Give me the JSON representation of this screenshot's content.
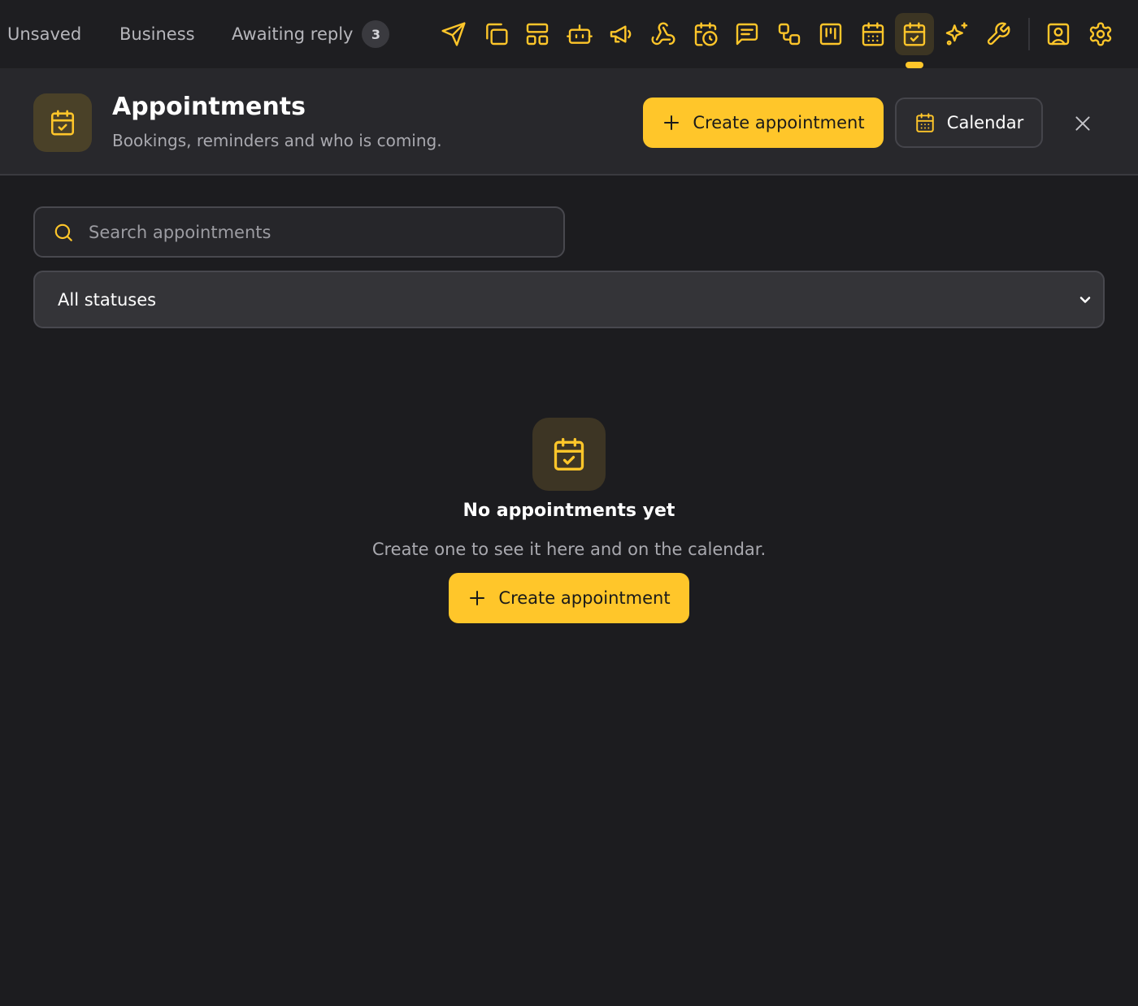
{
  "topbar": {
    "tabs": [
      {
        "label": "Unsaved"
      },
      {
        "label": "Business"
      },
      {
        "label": "Awaiting reply",
        "badge": "3"
      }
    ],
    "tools": [
      {
        "icon": "send-icon"
      },
      {
        "icon": "copy-icon"
      },
      {
        "icon": "layout-icon"
      },
      {
        "icon": "bot-icon"
      },
      {
        "icon": "megaphone-icon"
      },
      {
        "icon": "webhook-icon"
      },
      {
        "icon": "calendar-clock-icon"
      },
      {
        "icon": "message-square-icon"
      },
      {
        "icon": "workflow-icon"
      },
      {
        "icon": "kanban-icon"
      },
      {
        "icon": "calendar-grid-icon"
      },
      {
        "icon": "calendar-check-icon",
        "active": true
      },
      {
        "icon": "sparkles-icon"
      },
      {
        "icon": "wrench-icon"
      },
      {
        "icon": "contact-icon"
      },
      {
        "icon": "settings-icon"
      }
    ]
  },
  "header": {
    "title": "Appointments",
    "subtitle": "Bookings, reminders and who is coming.",
    "create_label": "Create appointment",
    "calendar_label": "Calendar",
    "icon": "calendar-check-icon"
  },
  "filters": {
    "search_placeholder": "Search appointments",
    "search_value": "",
    "status_selected": "All statuses"
  },
  "empty_state": {
    "title": "No appointments yet",
    "text": "Create one to see it here and on the calendar.",
    "button_label": "Create appointment"
  },
  "colors": {
    "accent": "#ffc62a",
    "background": "#1c1c1f",
    "panel": "#28282c"
  }
}
